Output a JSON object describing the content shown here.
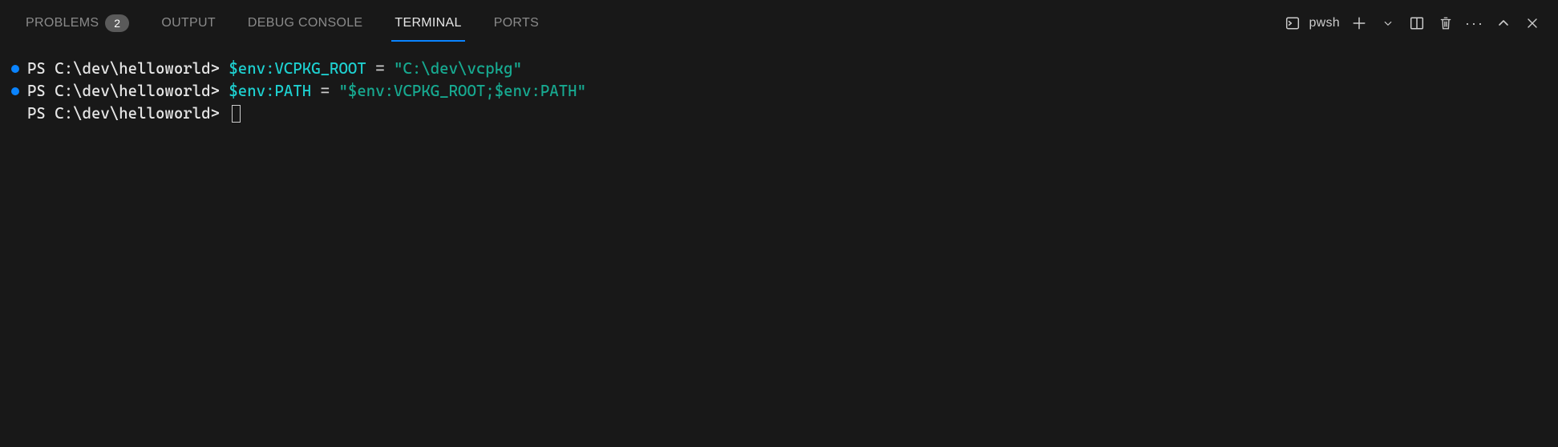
{
  "tabs": {
    "problems": {
      "label": "PROBLEMS",
      "badge": "2"
    },
    "output": {
      "label": "OUTPUT"
    },
    "debug": {
      "label": "DEBUG CONSOLE"
    },
    "terminal": {
      "label": "TERMINAL"
    },
    "ports": {
      "label": "PORTS"
    }
  },
  "shell": {
    "name": "pwsh"
  },
  "terminal": {
    "lines": [
      {
        "bullet": true,
        "segments": [
          {
            "cls": "prompt",
            "text": "PS C:\\dev\\helloworld> "
          },
          {
            "cls": "cmd",
            "text": "$env:VCPKG_ROOT "
          },
          {
            "cls": "op",
            "text": "= "
          },
          {
            "cls": "str",
            "text": "\"C:\\dev\\vcpkg\""
          }
        ]
      },
      {
        "bullet": true,
        "segments": [
          {
            "cls": "prompt",
            "text": "PS C:\\dev\\helloworld> "
          },
          {
            "cls": "cmd",
            "text": "$env:PATH "
          },
          {
            "cls": "op",
            "text": "= "
          },
          {
            "cls": "str",
            "text": "\"$env:VCPKG_ROOT;$env:PATH\""
          }
        ]
      },
      {
        "bullet": false,
        "segments": [
          {
            "cls": "prompt",
            "text": "PS C:\\dev\\helloworld> "
          }
        ],
        "cursor": true
      }
    ]
  }
}
